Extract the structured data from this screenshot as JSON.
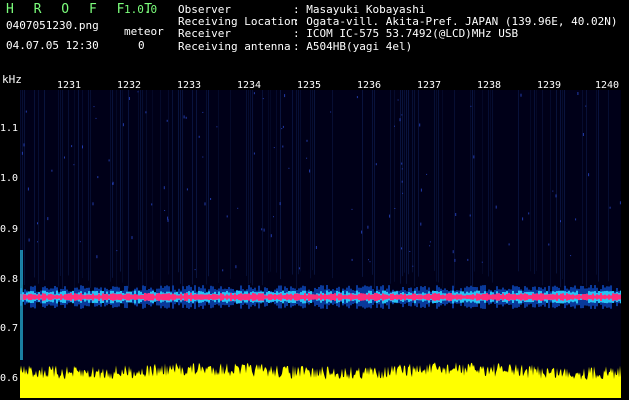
{
  "app": {
    "title": "H R O F F T",
    "version": "1.0.0"
  },
  "file": {
    "name": "0407051230.png",
    "datetime": "04.07.05 12:30",
    "meteor_label": "meteor",
    "meteor_count": "0"
  },
  "metadata": [
    {
      "key": "Observer",
      "value": ": Masayuki Kobayashi"
    },
    {
      "key": "Receiving Location",
      "value": ": Ogata-vill. Akita-Pref. JAPAN (139.96E, 40.02N)"
    },
    {
      "key": "Receiver",
      "value": ": ICOM IC-575 53.7492(@LCD)MHz USB"
    },
    {
      "key": "Receiving antenna",
      "value": ": A504HB(yagi 4el)"
    }
  ],
  "axis": {
    "unit": "kHz",
    "y_ticks": [
      "1.1",
      "1.0",
      "0.9",
      "0.8",
      "0.7",
      "0.6"
    ],
    "x_ticks": [
      "1231",
      "1232",
      "1233",
      "1234",
      "1235",
      "1236",
      "1237",
      "1238",
      "1239",
      "1240"
    ]
  },
  "colors": {
    "band_core": "#ff2d7a",
    "band_halo": "#2bd3ff",
    "power_fill": "#ffff00",
    "background": "#000018"
  }
}
